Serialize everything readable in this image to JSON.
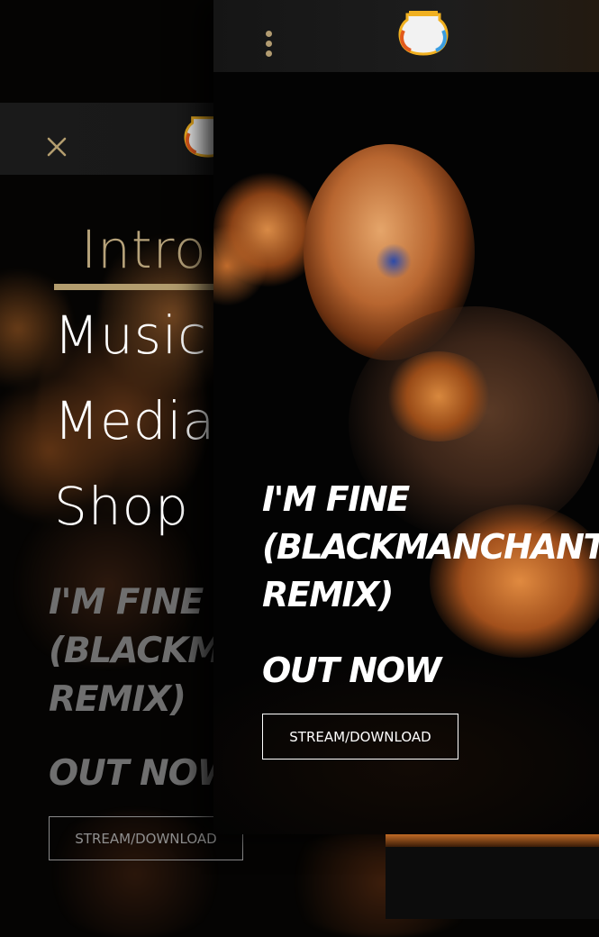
{
  "menu": {
    "items": [
      {
        "label": "Intro",
        "active": true
      },
      {
        "label": "Music",
        "active": false
      },
      {
        "label": "Media",
        "active": false
      },
      {
        "label": "Shop",
        "active": false
      }
    ]
  },
  "release": {
    "title": "I'M FINE\n(BLACKMANCHANT\nREMIX)",
    "tagline": "OUT NOW",
    "cta_label": "STREAM/DOWNLOAD"
  },
  "icons": {
    "close": "close-icon",
    "menu": "kebab-menu-icon",
    "logo": "jar-logo"
  },
  "colors": {
    "accent": "#b39d6e",
    "background": "#000000",
    "text": "#ffffff",
    "dimmed_text": "#6f6f6f"
  }
}
